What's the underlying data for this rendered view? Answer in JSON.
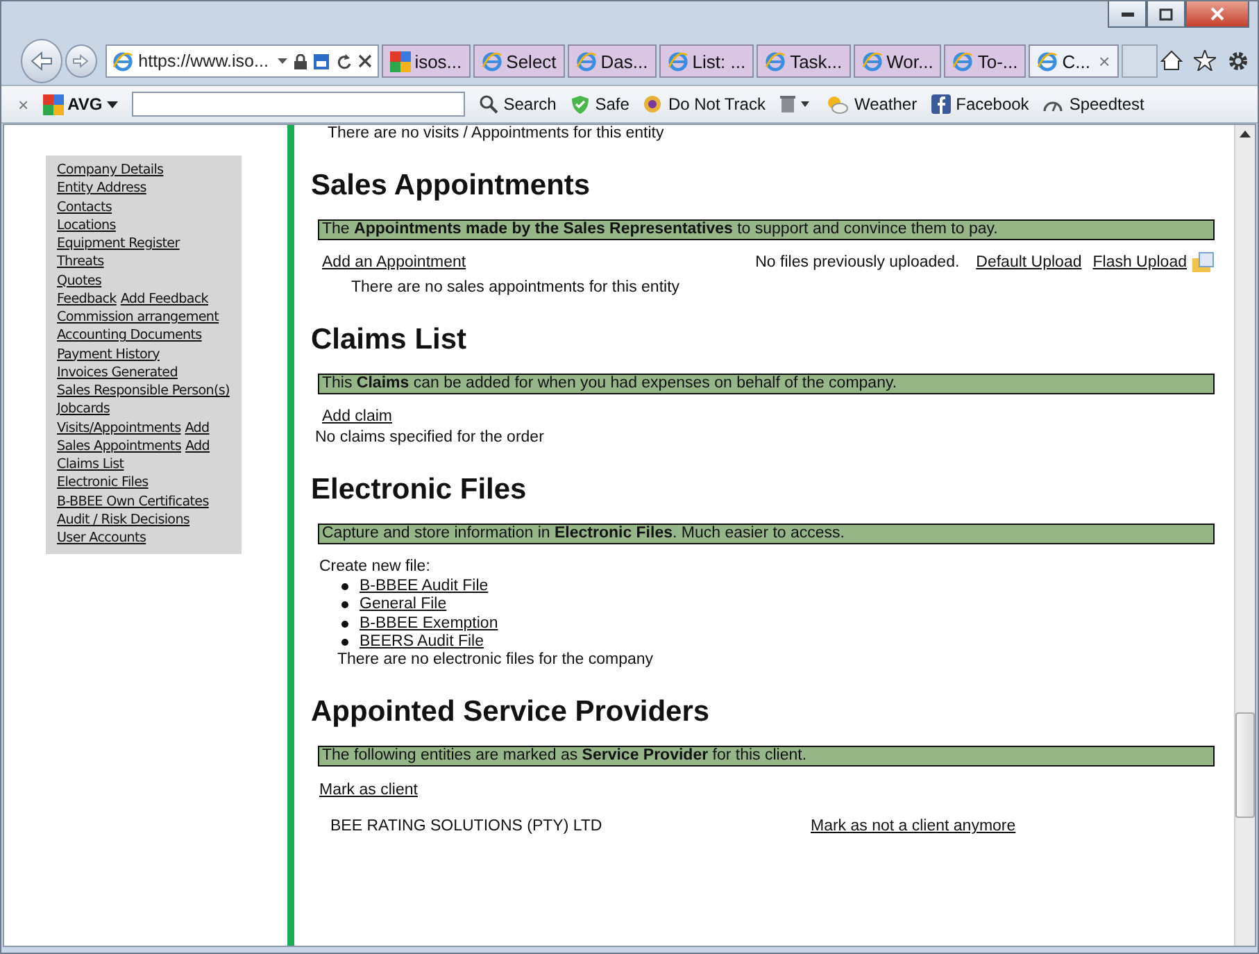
{
  "browser": {
    "address": "https://www.iso...",
    "tabs": [
      {
        "label": "isos...",
        "kind": "avg",
        "selected": false
      },
      {
        "label": "Select",
        "kind": "ie",
        "selected": false
      },
      {
        "label": "Das...",
        "kind": "ie",
        "selected": false
      },
      {
        "label": "List: ...",
        "kind": "ie",
        "selected": false
      },
      {
        "label": "Task...",
        "kind": "ie",
        "selected": false
      },
      {
        "label": "Wor...",
        "kind": "ie",
        "selected": false
      },
      {
        "label": "To-...",
        "kind": "ie",
        "selected": false
      },
      {
        "label": "C...",
        "kind": "ie",
        "selected": true,
        "close": "×"
      }
    ],
    "toolbar": {
      "close": "×",
      "brand": "AVG",
      "items": [
        {
          "label": "Search",
          "kind": "search"
        },
        {
          "label": "Safe",
          "kind": "shield"
        },
        {
          "label": "Do Not Track",
          "kind": "eye"
        },
        {
          "kind": "trash"
        },
        {
          "label": "Weather",
          "kind": "weather"
        },
        {
          "label": "Facebook",
          "kind": "facebook"
        },
        {
          "label": "Speedtest",
          "kind": "gauge"
        }
      ]
    }
  },
  "sidebar": {
    "items": [
      {
        "links": [
          "Company Details"
        ]
      },
      {
        "links": [
          "Entity Address"
        ]
      },
      {
        "links": [
          "Contacts"
        ]
      },
      {
        "links": [
          "Locations"
        ]
      },
      {
        "links": [
          "Equipment Register"
        ]
      },
      {
        "links": [
          "Threats"
        ]
      },
      {
        "links": [
          "Quotes"
        ]
      },
      {
        "links": [
          "Feedback",
          "Add Feedback"
        ]
      },
      {
        "links": [
          "Commission arrangement"
        ]
      },
      {
        "links": [
          "Accounting Documents"
        ]
      },
      {
        "links": [
          "Payment History"
        ]
      },
      {
        "links": [
          "Invoices Generated"
        ]
      },
      {
        "links": [
          "Sales Responsible Person(s)"
        ]
      },
      {
        "links": [
          "Jobcards"
        ]
      },
      {
        "links": [
          "Visits/Appointments",
          "Add"
        ]
      },
      {
        "links": [
          "Sales Appointments",
          "Add"
        ]
      },
      {
        "links": [
          "Claims List"
        ]
      },
      {
        "links": [
          "Electronic Files"
        ]
      },
      {
        "links": [
          "B-BBEE Own Certificates"
        ]
      },
      {
        "links": [
          "Audit / Risk Decisions"
        ]
      },
      {
        "links": [
          "User Accounts"
        ]
      }
    ]
  },
  "top_note": "There are no visits / Appointments for this entity",
  "sections": [
    {
      "kind": "appointments",
      "title": "Sales Appointments",
      "banner": "The **Appointments made by the Sales Representatives** to support and convince them to pay.",
      "action": "Add an Appointment",
      "empty": "There are no sales appointments for this entity",
      "uploads": {
        "note": "No files previously uploaded.",
        "links": [
          "Default Upload",
          "Flash Upload"
        ]
      }
    },
    {
      "kind": "claims",
      "title": "Claims List",
      "banner": "This **Claims** can be added for when you had expenses on behalf of the company.",
      "action": "Add claim",
      "empty": "No claims specified for the order"
    },
    {
      "kind": "files",
      "title": "Electronic Files",
      "banner": "Capture and store information in **Electronic Files**. Much easier to access.",
      "intro": "Create new file:",
      "files": [
        "B-BBEE Audit File",
        "General File",
        "B-BBEE Exemption",
        "BEERS Audit File"
      ],
      "empty": "There are no electronic files for the company"
    },
    {
      "kind": "providers",
      "title": "Appointed Service Providers",
      "banner": "The following entities are marked as **Service Provider** for this client.",
      "action": "Mark as client",
      "providers": [
        {
          "name": "BEE RATING SOLUTIONS (PTY) LTD",
          "action": "Mark as not a client anymore"
        }
      ]
    }
  ]
}
